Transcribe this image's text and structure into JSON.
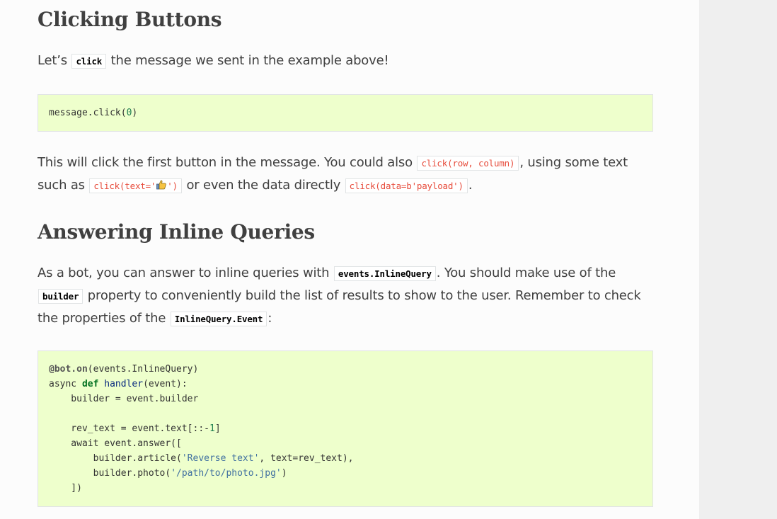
{
  "section1": {
    "heading": "Clicking Buttons",
    "intro_before": "Let’s ",
    "intro_code": "click",
    "intro_after": " the message we sent in the example above!",
    "code": "message.click(0)",
    "para_a": "This will click the first button in the message. You could also ",
    "code_rowcol": "click(row, column)",
    "para_b": ", using some text",
    "para_c": "such as ",
    "code_text_pre": "click(text='",
    "code_text_post": "')",
    "para_d": " or even the data directly ",
    "code_data": "click(data=b'payload')",
    "para_e": "."
  },
  "section2": {
    "heading": "Answering Inline Queries",
    "p1": "As a bot, you can answer to inline queries with ",
    "code_event": "events.InlineQuery",
    "p2": ". You should make use of the",
    "code_builder": "builder",
    "p3": " property to conveniently build the list of results to show to the user. Remember to check",
    "p4": "the properties of the ",
    "code_iqe": "InlineQuery.Event",
    "p5": ":",
    "code_lines": [
      "@bot.on(events.InlineQuery)",
      "async def handler(event):",
      "    builder = event.builder",
      "",
      "    rev_text = event.text[::-1]",
      "    await event.answer([",
      "        builder.article('Reverse text', text=rev_text),",
      "        builder.photo('/path/to/photo.jpg')",
      "    ])"
    ]
  },
  "colors": {
    "code_bg": "#eeffcc",
    "inline_red": "#e74c3c",
    "sidebar_bg": "#efefef"
  }
}
